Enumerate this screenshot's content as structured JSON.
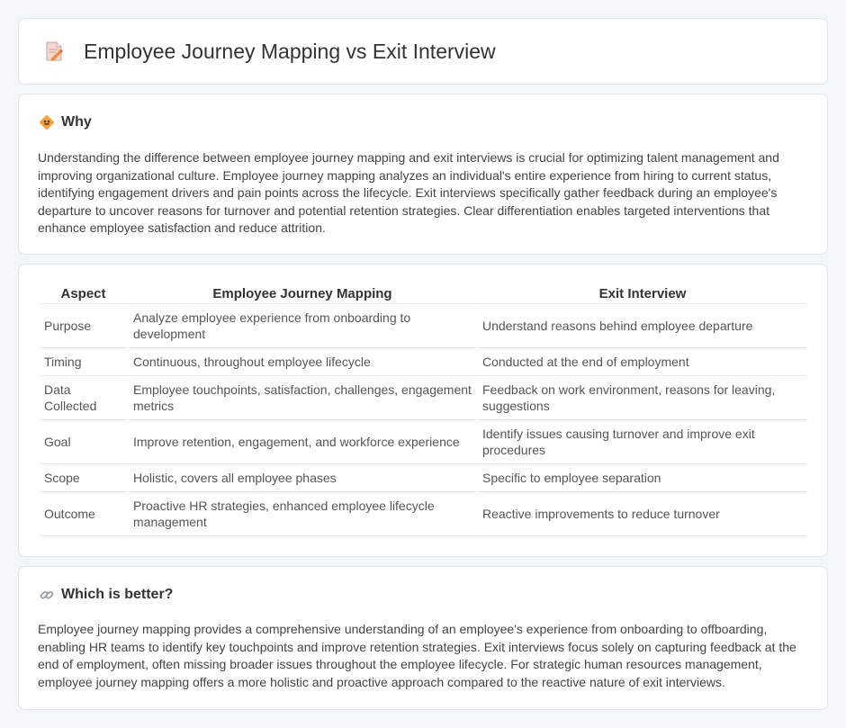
{
  "header": {
    "title": "Employee Journey Mapping vs Exit Interview",
    "icon": "document-pencil-icon"
  },
  "why": {
    "icon": "diamond-sign-icon",
    "heading": "Why",
    "text": "Understanding the difference between employee journey mapping and exit interviews is crucial for optimizing talent management and improving organizational culture. Employee journey mapping analyzes an individual's entire experience from hiring to current status, identifying engagement drivers and pain points across the lifecycle. Exit interviews specifically gather feedback during an employee's departure to uncover reasons for turnover and potential retention strategies. Clear differentiation enables targeted interventions that enhance employee satisfaction and reduce attrition."
  },
  "comparison": {
    "headers": [
      "Aspect",
      "Employee Journey Mapping",
      "Exit Interview"
    ],
    "rows": [
      [
        "Purpose",
        "Analyze employee experience from onboarding to development",
        "Understand reasons behind employee departure"
      ],
      [
        "Timing",
        "Continuous, throughout employee lifecycle",
        "Conducted at the end of employment"
      ],
      [
        "Data Collected",
        "Employee touchpoints, satisfaction, challenges, engagement metrics",
        "Feedback on work environment, reasons for leaving, suggestions"
      ],
      [
        "Goal",
        "Improve retention, engagement, and workforce experience",
        "Identify issues causing turnover and improve exit procedures"
      ],
      [
        "Scope",
        "Holistic, covers all employee phases",
        "Specific to employee separation"
      ],
      [
        "Outcome",
        "Proactive HR strategies, enhanced employee lifecycle management",
        "Reactive improvements to reduce turnover"
      ]
    ]
  },
  "better": {
    "icon": "link-icon",
    "heading": "Which is better?",
    "text": "Employee journey mapping provides a comprehensive understanding of an employee's experience from onboarding to offboarding, enabling HR teams to identify key touchpoints and improve retention strategies. Exit interviews focus solely on capturing feedback at the end of employment, often missing broader issues throughout the employee lifecycle. For strategic human resources management, employee journey mapping offers a more holistic and proactive approach compared to the reactive nature of exit interviews."
  }
}
